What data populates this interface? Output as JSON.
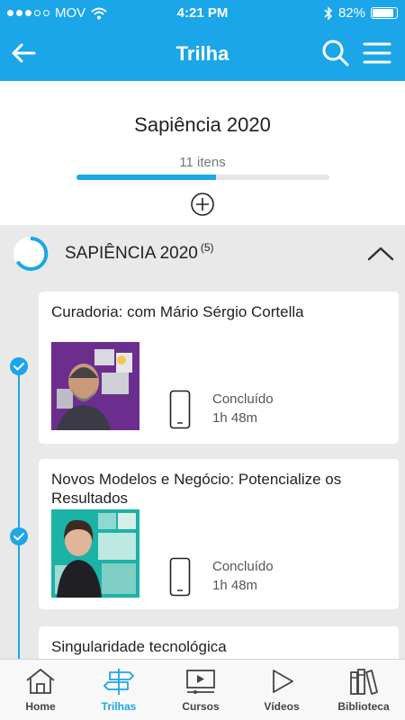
{
  "status_bar": {
    "carrier": "MOV",
    "time": "4:21 PM",
    "battery": "82%"
  },
  "app_bar": {
    "title": "Trilha"
  },
  "trail": {
    "title": "Sapiência 2020",
    "item_count": "11 itens",
    "progress_fraction": 0.55
  },
  "section": {
    "title": "SAPIÊNCIA 2020",
    "count": "(5)"
  },
  "cards": [
    {
      "title": "Curadoria: com Mário Sérgio Cortella",
      "status": "Concluído",
      "duration": "1h 48m"
    },
    {
      "title": "Novos Modelos e Negócio: Potencialize os Resultados",
      "status": "Concluído",
      "duration": "1h 48m"
    },
    {
      "title": "Singularidade tecnológica"
    }
  ],
  "tabs": [
    {
      "label": "Home",
      "icon": "home-icon"
    },
    {
      "label": "Trilhas",
      "icon": "signpost-icon",
      "active": true
    },
    {
      "label": "Cursos",
      "icon": "course-player-icon"
    },
    {
      "label": "Vídeos",
      "icon": "play-icon"
    },
    {
      "label": "Biblioteca",
      "icon": "books-icon"
    }
  ],
  "colors": {
    "accent": "#1aa6e8",
    "thumb_purple": "#6b2e8f",
    "thumb_teal": "#1bb3a6"
  }
}
